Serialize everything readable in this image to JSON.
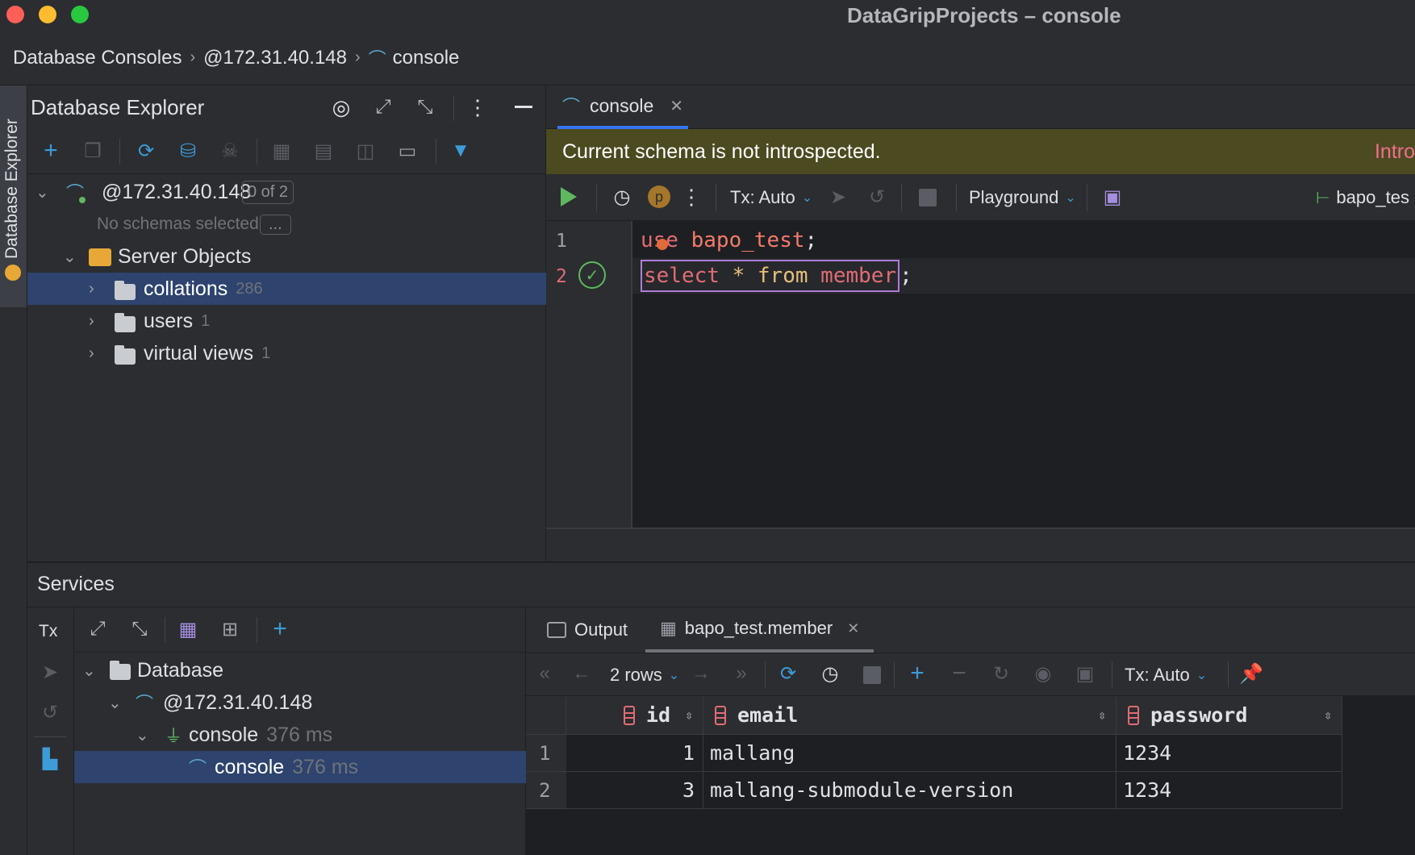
{
  "window": {
    "title": "DataGripProjects – console",
    "traffic_colors": [
      "#ff5f57",
      "#febc2e",
      "#28c840"
    ]
  },
  "breadcrumb": {
    "items": [
      "Database Consoles",
      "@172.31.40.148",
      "console"
    ]
  },
  "left_stripe": {
    "tab_label": "Database Explorer"
  },
  "db_explorer": {
    "title": "Database Explorer",
    "connection": {
      "host": "@172.31.40.148",
      "schema_badge": "0 of 2",
      "no_schemas": "No schemas selected",
      "more_button": "..."
    },
    "server_objects": {
      "label": "Server Objects",
      "children": [
        {
          "label": "collations",
          "count": "286"
        },
        {
          "label": "users",
          "count": "1"
        },
        {
          "label": "virtual views",
          "count": "1"
        }
      ]
    }
  },
  "editor": {
    "tab_label": "console",
    "banner_text": "Current schema is not introspected.",
    "banner_link": "Intro",
    "toolbar": {
      "p_badge": "p",
      "tx_label": "Tx: Auto",
      "playground_label": "Playground",
      "schema_label": "bapo_tes"
    },
    "lines": [
      {
        "number": "1",
        "tokens": [
          [
            "kw",
            "use"
          ],
          [
            "punct",
            " "
          ],
          [
            "str",
            "bapo_test"
          ],
          [
            "punct",
            ";"
          ]
        ]
      },
      {
        "number": "2",
        "tokens": [
          [
            "kw",
            "select"
          ],
          [
            "punct",
            " "
          ],
          [
            "op",
            "*"
          ],
          [
            "punct",
            " "
          ],
          [
            "op",
            "from"
          ],
          [
            "punct",
            " "
          ],
          [
            "kw",
            "member"
          ],
          [
            "punct",
            ";"
          ]
        ]
      }
    ]
  },
  "services": {
    "title": "Services",
    "tx_label": "Tx",
    "tree": [
      {
        "label": "Database",
        "time": ""
      },
      {
        "label": "@172.31.40.148",
        "time": ""
      },
      {
        "label": "console",
        "time": "376 ms"
      },
      {
        "label": "console",
        "time": "376 ms"
      }
    ],
    "results": {
      "output_tab": "Output",
      "table_tab": "bapo_test.member",
      "rows_label": "2 rows",
      "tx_label": "Tx: Auto",
      "columns": [
        "id",
        "email",
        "password"
      ],
      "rows": [
        {
          "num": "1",
          "id": "1",
          "email": "mallang",
          "password": "1234"
        },
        {
          "num": "2",
          "id": "3",
          "email": "mallang-submodule-version",
          "password": "1234"
        }
      ]
    }
  }
}
